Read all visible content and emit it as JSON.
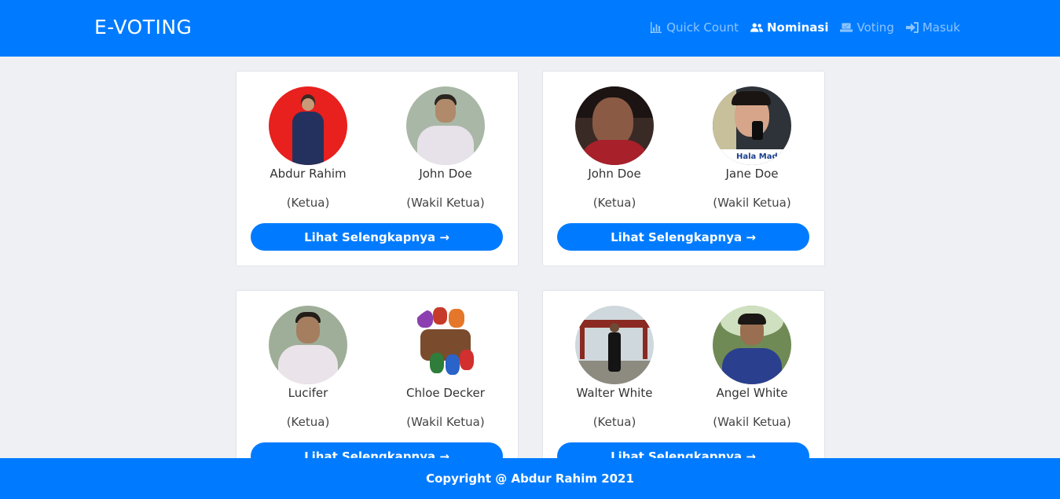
{
  "navbar": {
    "brand": "E-VOTING",
    "items": [
      {
        "label": "Quick Count",
        "icon": "chart-bar-icon",
        "active": false
      },
      {
        "label": "Nominasi",
        "icon": "users-icon",
        "active": true
      },
      {
        "label": "Voting",
        "icon": "vote-box-icon",
        "active": false
      },
      {
        "label": "Masuk",
        "icon": "sign-in-icon",
        "active": false
      }
    ]
  },
  "candidates": [
    {
      "chair": {
        "name": "Abdur Rahim",
        "role": "(Ketua)"
      },
      "vice": {
        "name": "John Doe",
        "role": "(Wakil Ketua)"
      },
      "button": "Lihat Selengkapnya →"
    },
    {
      "chair": {
        "name": "John Doe",
        "role": "(Ketua)"
      },
      "vice": {
        "name": "Jane Doe",
        "role": "(Wakil Ketua)"
      },
      "button": "Lihat Selengkapnya →"
    },
    {
      "chair": {
        "name": "Lucifer",
        "role": "(Ketua)"
      },
      "vice": {
        "name": "Chloe Decker",
        "role": "(Wakil Ketua)"
      },
      "button": "Lihat Selengkapnya →"
    },
    {
      "chair": {
        "name": "Walter White",
        "role": "(Ketua)"
      },
      "vice": {
        "name": "Angel White",
        "role": "(Wakil Ketua)"
      },
      "button": "Lihat Selengkapnya →"
    }
  ],
  "photo_overlay_text": "Hala Mad",
  "footer": {
    "text": "Copyright @ Abdur Rahim 2021"
  },
  "colors": {
    "primary": "#007bff",
    "background": "#eef0f4"
  }
}
